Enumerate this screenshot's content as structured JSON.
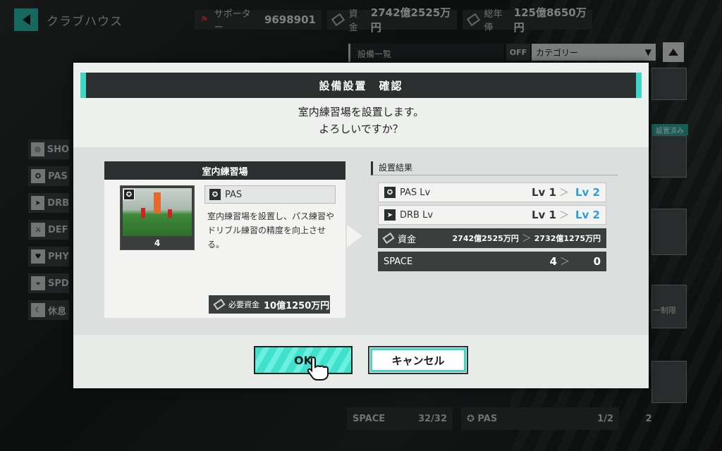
{
  "header": {
    "title": "クラブハウス",
    "supporters_label": "サポーター",
    "supporters_value": "9698901",
    "funds_label": "資金",
    "funds_value": "2742億2525万円",
    "salary_label": "総年俸",
    "salary_value": "125億8650万円"
  },
  "filter": {
    "label": "設備一覧",
    "off_tag": "OFF",
    "category": "カテゴリー"
  },
  "sidebar": {
    "items": [
      {
        "label": "SHO",
        "icon": "shoot-icon"
      },
      {
        "label": "PAS",
        "icon": "pass-icon"
      },
      {
        "label": "DRB",
        "icon": "dribble-icon"
      },
      {
        "label": "DEF",
        "icon": "defense-icon"
      },
      {
        "label": "PHY",
        "icon": "physical-icon"
      },
      {
        "label": "SPD",
        "icon": "speed-icon"
      },
      {
        "label": "休息",
        "icon": "rest-icon"
      }
    ]
  },
  "right_panel": {
    "installed_tag": "設置済み",
    "limit_label": "一制限"
  },
  "bottom": {
    "space_label": "SPACE",
    "space_value": "32/32",
    "pas_label": "PAS",
    "pas_value": "1/2",
    "extra_value": "2"
  },
  "modal": {
    "title": "設備設置　確認",
    "message_line1": "室内練習場を設置します。",
    "message_line2": "よろしいですか？",
    "facility": {
      "name": "室内練習場",
      "level": "4",
      "tag": "PAS",
      "description": "室内練習場を設置し、パス練習やドリブル練習の精度を向上させる。",
      "cost_label": "必要資金",
      "cost_value": "10億1250万円"
    },
    "result_title": "設置結果",
    "results": [
      {
        "name": "PAS Lv",
        "from": "Lv 1",
        "to": "Lv 2"
      },
      {
        "name": "DRB Lv",
        "from": "Lv 1",
        "to": "Lv 2"
      }
    ],
    "funds_row": {
      "name": "資金",
      "from": "2742億2525万円",
      "to": "2732億1275万円"
    },
    "space_row": {
      "name": "SPACE",
      "from": "4",
      "to": "0"
    },
    "ok_label": "OK",
    "cancel_label": "キャンセル"
  },
  "colors": {
    "accent": "#3fd6c6",
    "level_up": "#2a9fd6",
    "panel_dark": "#2c2f2f"
  }
}
